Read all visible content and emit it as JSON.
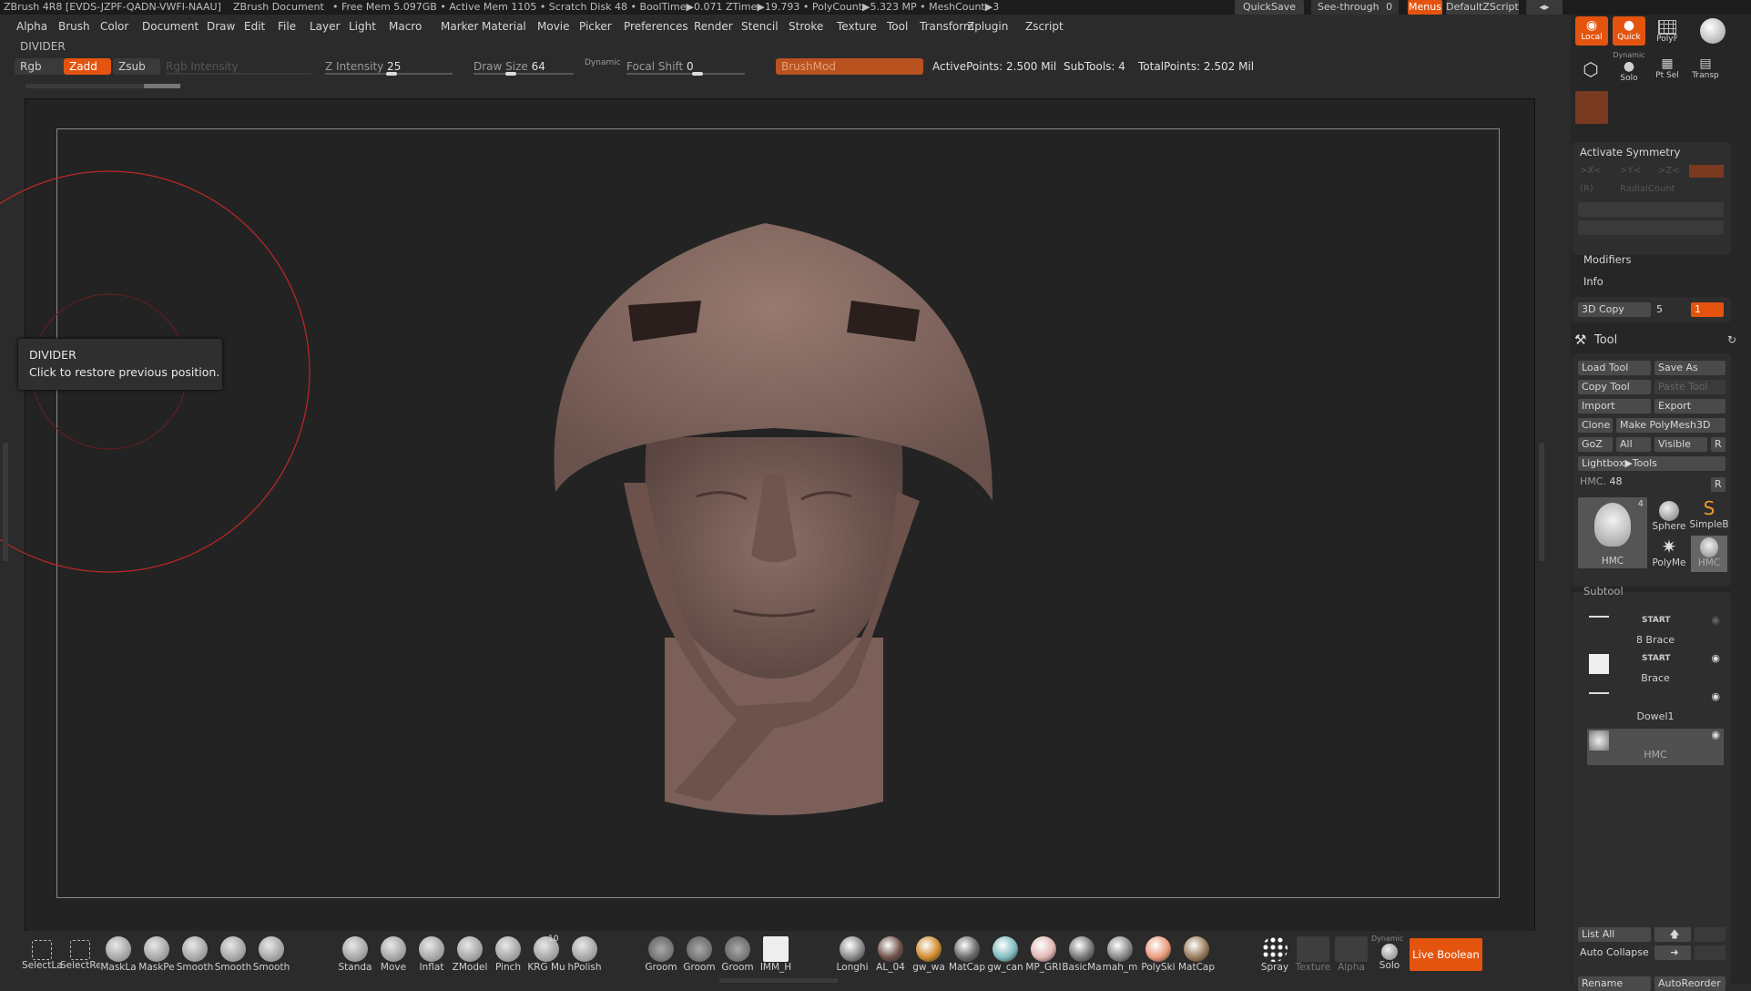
{
  "titlebar": {
    "app": "ZBrush 4R8 [EVDS-JZPF-QADN-VWFI-NAAU]",
    "document": "ZBrush Document",
    "stats": "• Free Mem 5.097GB • Active Mem 1105 • Scratch Disk 48 • BoolTime▶0.071 ZTime▶19.793 • PolyCount▶5.323 MP • MeshCount▶3",
    "quicksave": "QuickSave",
    "see_through": "See-through",
    "see_through_value": "0",
    "menus": "Menus",
    "script": "DefaultZScript"
  },
  "menubar": [
    "Alpha",
    "Brush",
    "Color",
    "Document",
    "Draw",
    "Edit",
    "File",
    "Layer",
    "Light",
    "Macro",
    "Marker",
    "Material",
    "Movie",
    "Picker",
    "Preferences",
    "Render",
    "Stencil",
    "Stroke",
    "Texture",
    "Tool",
    "Transform",
    "Zplugin",
    "Zscript"
  ],
  "divider_label": "DIVIDER",
  "toolbar": {
    "rgb": "Rgb",
    "zadd": "Zadd",
    "zsub": "Zsub",
    "rgb_intensity": "Rgb Intensity",
    "z_intensity_label": "Z Intensity",
    "z_intensity": "25",
    "draw_size_label": "Draw Size",
    "draw_size": "64",
    "dynamic": "Dynamic",
    "focal_shift_label": "Focal Shift",
    "focal_shift": "0",
    "brushmod": "BrushMod",
    "active_points": "ActivePoints: 2.500 Mil",
    "subtools": "SubTools: 4",
    "total_points": "TotalPoints: 2.502 Mil"
  },
  "tooltip": {
    "title": "DIVIDER",
    "text": "Click to restore previous position."
  },
  "shelf": {
    "left": [
      "SelectLa",
      "SelectRe",
      "MaskLa",
      "MaskPe",
      "Smooth",
      "Smooth",
      "Smooth"
    ],
    "brushes": [
      "Standa",
      "Move",
      "Inflat",
      "ZModel",
      "Pinch",
      "KRG Mu",
      "hPolish"
    ],
    "groom": [
      "Groom",
      "Groom",
      "Groom",
      "IMM_H"
    ],
    "materials": [
      "Longhi",
      "AL_04",
      "gw_wa",
      "MatCap",
      "gw_can",
      "MP_GRI",
      "BasicMa",
      "mah_m",
      "PolySki",
      "MatCap"
    ],
    "krg_badge": "10",
    "spray": "Spray",
    "texture": "Texture",
    "alpha": "Alpha",
    "solo": "Solo",
    "solo_dynamic": "Dynamic",
    "live_boolean": "Live Boolean"
  },
  "rightpanel": {
    "top_buttons": {
      "local": "Local",
      "quick": "Quick",
      "polyf": "PolyF",
      "solo": "Solo",
      "solo_dynamic": "Dynamic",
      "ptsel": "Pt Sel",
      "transp": "Transp"
    },
    "activate_symmetry": "Activate Symmetry",
    "sym_x": ">X<",
    "sym_y": ">Y<",
    "sym_z": ">Z<",
    "sym_r": "(R)",
    "radial_count": "RadialCount",
    "modifiers": "Modifiers",
    "info": "Info",
    "copy3d": "3D Copy",
    "copy3d_value": "5",
    "copy3d_orange": "1",
    "tool_header": "Tool",
    "load_tool": "Load Tool",
    "save_as": "Save As",
    "copy_tool": "Copy Tool",
    "paste_tool": "Paste Tool",
    "import": "Import",
    "export": "Export",
    "clone": "Clone",
    "make_polymesh": "Make PolyMesh3D",
    "goz": "GoZ",
    "all": "All",
    "visible": "Visible",
    "r": "R",
    "lightbox_tools": "Lightbox▶Tools",
    "hmc_label": "HMC.",
    "hmc_value": "48",
    "thumbs": {
      "hmc": "HMC",
      "hmc_count": "4",
      "sphere": "Sphere",
      "simple": "SimpleB",
      "polymesh": "PolyMe",
      "hmc2": "HMC"
    },
    "subtool_header": "Subtool",
    "subtools": [
      {
        "name": "8 Brace",
        "tag": "START"
      },
      {
        "name": "Brace",
        "tag": "START"
      },
      {
        "name": "Dowel1",
        "tag": ""
      },
      {
        "name": "HMC",
        "tag": ""
      }
    ],
    "list_all": "List All",
    "auto_collapse": "Auto Collapse",
    "rename": "Rename",
    "auto_reorder": "AutoReorder"
  },
  "colors": {
    "accent": "#e4540f",
    "ring": "#c0262b",
    "bg": "#2b2b2b",
    "canvas": "#232323",
    "model": "#8a6b62"
  }
}
